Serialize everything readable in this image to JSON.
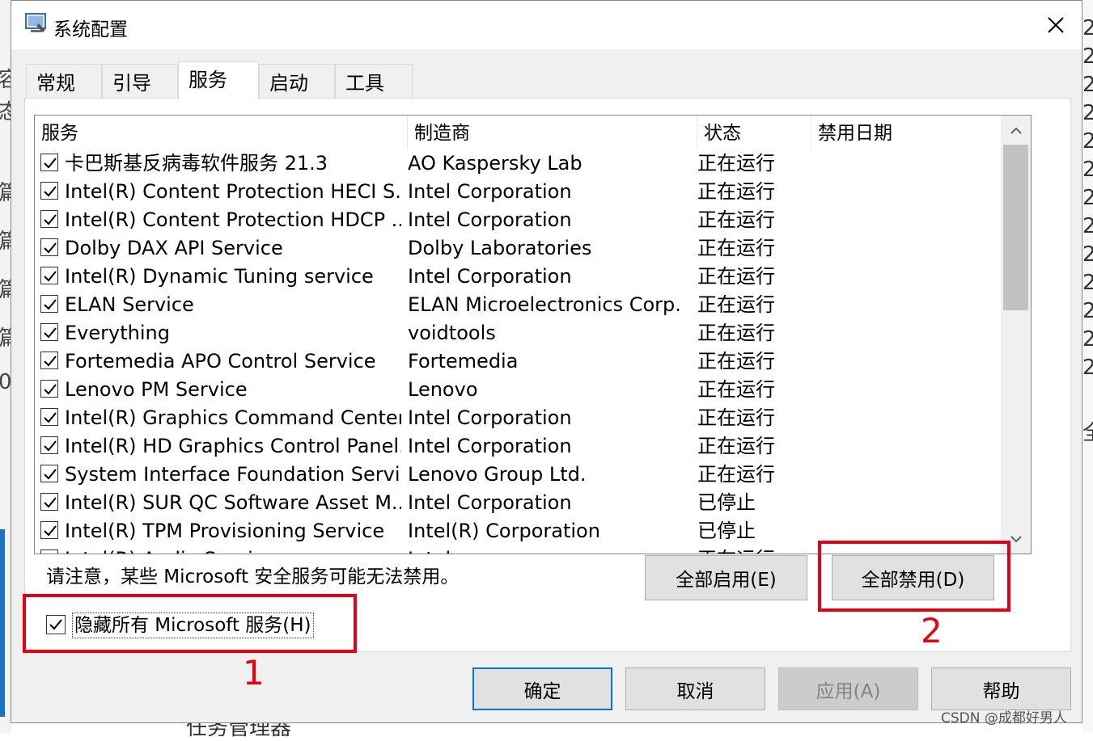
{
  "window": {
    "title": "系统配置",
    "close_glyph": "✕"
  },
  "tabs": [
    {
      "label": "常规"
    },
    {
      "label": "引导"
    },
    {
      "label": "服务"
    },
    {
      "label": "启动"
    },
    {
      "label": "工具"
    }
  ],
  "active_tab": "服务",
  "services": {
    "columns": [
      "服务",
      "制造商",
      "状态",
      "禁用日期"
    ],
    "rows": [
      {
        "name": "卡巴斯基反病毒软件服务 21.3",
        "manufacturer": "AO Kaspersky Lab",
        "status": "正在运行",
        "checked": true
      },
      {
        "name": "Intel(R) Content Protection HECI S...",
        "manufacturer": "Intel Corporation",
        "status": "正在运行",
        "checked": true
      },
      {
        "name": "Intel(R) Content Protection HDCP ...",
        "manufacturer": "Intel Corporation",
        "status": "正在运行",
        "checked": true
      },
      {
        "name": "Dolby DAX API Service",
        "manufacturer": "Dolby Laboratories",
        "status": "正在运行",
        "checked": true
      },
      {
        "name": "Intel(R) Dynamic Tuning service",
        "manufacturer": "Intel Corporation",
        "status": "正在运行",
        "checked": true
      },
      {
        "name": "ELAN Service",
        "manufacturer": "ELAN Microelectronics Corp.",
        "status": "正在运行",
        "checked": true
      },
      {
        "name": "Everything",
        "manufacturer": "voidtools",
        "status": "正在运行",
        "checked": true
      },
      {
        "name": "Fortemedia APO Control Service",
        "manufacturer": "Fortemedia",
        "status": "正在运行",
        "checked": true
      },
      {
        "name": "Lenovo PM Service",
        "manufacturer": "Lenovo",
        "status": "正在运行",
        "checked": true
      },
      {
        "name": "Intel(R) Graphics Command Center...",
        "manufacturer": "Intel Corporation",
        "status": "正在运行",
        "checked": true
      },
      {
        "name": "Intel(R) HD Graphics Control Panel...",
        "manufacturer": "Intel Corporation",
        "status": "正在运行",
        "checked": true
      },
      {
        "name": "System Interface Foundation Servi...",
        "manufacturer": "Lenovo Group Ltd.",
        "status": "正在运行",
        "checked": true
      },
      {
        "name": "Intel(R) SUR QC Software Asset M...",
        "manufacturer": "Intel Corporation",
        "status": "已停止",
        "checked": true
      },
      {
        "name": "Intel(R) TPM Provisioning Service",
        "manufacturer": "Intel(R) Corporation",
        "status": "已停止",
        "checked": true
      },
      {
        "name": "Intel(R) Audio Service",
        "manufacturer": "Intel",
        "status": "正在运行",
        "checked": true
      }
    ]
  },
  "notice": "请注意，某些 Microsoft 安全服务可能无法禁用。",
  "buttons": {
    "enable_all": "全部启用(E)",
    "disable_all": "全部禁用(D)",
    "ok": "确定",
    "cancel": "取消",
    "apply": "应用(A)",
    "help": "帮助"
  },
  "hide_ms_services": {
    "label": "隐藏所有 Microsoft 服务(H)",
    "checked": true
  },
  "annotations": [
    {
      "label": "1",
      "color": "#e60012"
    },
    {
      "label": "2",
      "color": "#e60012"
    }
  ],
  "watermark": "CSDN @成都好男人",
  "background_app": {
    "bottom_text": "任务管理器"
  },
  "icons": [
    "system-config-app-icon",
    "close-icon",
    "checkbox-checked-icon",
    "scroll-up-arrow-icon",
    "scroll-down-arrow-icon"
  ]
}
